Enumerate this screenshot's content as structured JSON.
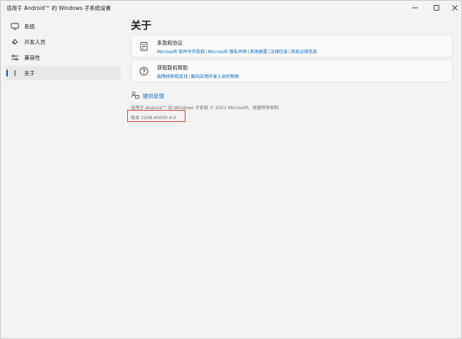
{
  "window": {
    "title": "适用于 Android™ 的 Windows 子系统设置",
    "controls": {
      "minimize": "minimize-icon",
      "maximize": "maximize-icon",
      "close": "close-icon"
    }
  },
  "sidebar": {
    "items": [
      {
        "label": "系统",
        "icon": "monitor-icon",
        "selected": false
      },
      {
        "label": "开发人员",
        "icon": "developer-icon",
        "selected": false
      },
      {
        "label": "兼容性",
        "icon": "sliders-icon",
        "selected": false
      },
      {
        "label": "关于",
        "icon": "info-icon",
        "selected": true
      }
    ]
  },
  "main": {
    "title": "关于",
    "cards": {
      "terms": {
        "title": "条款和协议",
        "icon": "document-icon",
        "links": [
          "Microsoft 软件许可条款",
          "Microsoft 隐私声明",
          "其他披露",
          "法律信息",
          "其他法律信息"
        ],
        "separator": "|"
      },
      "help": {
        "title": "获取联机帮助",
        "icon": "help-icon",
        "links": [
          "故障排除和支持",
          "面向应用开发人员的帮助"
        ],
        "separator": "|"
      }
    },
    "feedback": {
      "label": "提供反馈",
      "icon": "feedback-icon"
    },
    "copyright": "适用于 Android™ 的 Windows 子系统 © 2021 Microsoft。保留所有权利",
    "version": "版本 2208.40000.4.0"
  },
  "colors": {
    "link": "#0067c0",
    "accent": "#005fb8",
    "highlight": "#e53935",
    "background": "#f3f3f3",
    "card": "#fbfbfb"
  }
}
